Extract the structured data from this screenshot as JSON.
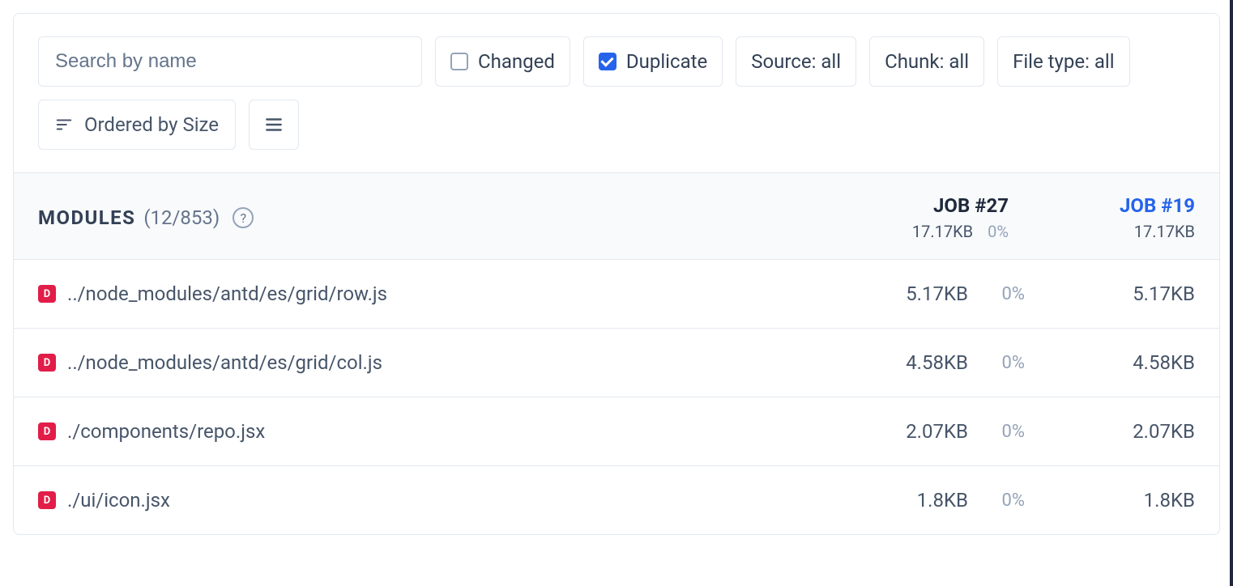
{
  "search": {
    "placeholder": "Search by name"
  },
  "filters": {
    "changed": {
      "label": "Changed",
      "checked": false
    },
    "duplicate": {
      "label": "Duplicate",
      "checked": true
    },
    "source": {
      "label": "Source: all"
    },
    "chunk": {
      "label": "Chunk: all"
    },
    "filetype": {
      "label": "File type: all"
    }
  },
  "sort": {
    "label": "Ordered by Size"
  },
  "header": {
    "title": "MODULES",
    "count": "(12/853)",
    "jobs": [
      {
        "name": "JOB #27",
        "size": "17.17KB",
        "delta": "0%",
        "link": false
      },
      {
        "name": "JOB #19",
        "size": "17.17KB",
        "link": true
      }
    ]
  },
  "rows": [
    {
      "path": "../node_modules/antd/es/grid/row.js",
      "size1": "5.17KB",
      "delta": "0%",
      "size2": "5.17KB"
    },
    {
      "path": "../node_modules/antd/es/grid/col.js",
      "size1": "4.58KB",
      "delta": "0%",
      "size2": "4.58KB"
    },
    {
      "path": "./components/repo.jsx",
      "size1": "2.07KB",
      "delta": "0%",
      "size2": "2.07KB"
    },
    {
      "path": "./ui/icon.jsx",
      "size1": "1.8KB",
      "delta": "0%",
      "size2": "1.8KB"
    }
  ]
}
